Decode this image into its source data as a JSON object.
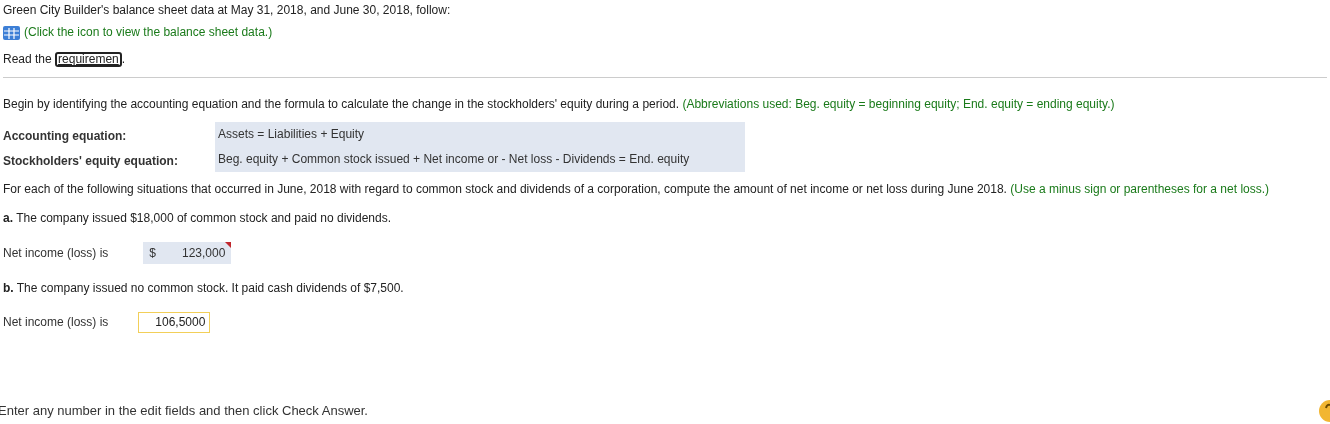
{
  "intro": "Green City Builder's balance sheet data at May 31, 2018, and June 30, 2018, follow:",
  "data_link": "(Click the icon to view the balance sheet data.)",
  "read_prefix": "Read the ",
  "requirements_link": "requiremen",
  "read_suffix": ".",
  "instruction": "Begin by identifying the accounting equation and the formula to calculate the change in the stockholders' equity during a period.",
  "instruction_hint": "(Abbreviations used: Beg. equity = beginning equity; End. equity = ending equity.)",
  "equations": [
    {
      "label": "Accounting equation:",
      "value": "Assets = Liabilities + Equity"
    },
    {
      "label": "Stockholders' equity equation:",
      "value": "Beg. equity + Common stock issued + Net income or - Net loss - Dividends = End. equity"
    }
  ],
  "question": "For each of the following situations that occurred in June, 2018 with regard to common stock and dividends of a corporation, compute the amount of net income or net loss during June 2018.",
  "question_hint": "(Use a minus sign or parentheses for a net loss.)",
  "situations": [
    {
      "text": "**a.** The company issued $18,000 of common stock and paid no dividends.",
      "label": "Net income (loss) is",
      "kind": "graded",
      "currency": "$",
      "value": "123,000"
    },
    {
      "text": "**b.** The company issued no common stock. It paid cash dividends of $7,500.",
      "label": "Net income (loss) is",
      "kind": "active",
      "value": "106,5000"
    }
  ],
  "footer": "Enter any number in the edit fields and then click Check Answer."
}
